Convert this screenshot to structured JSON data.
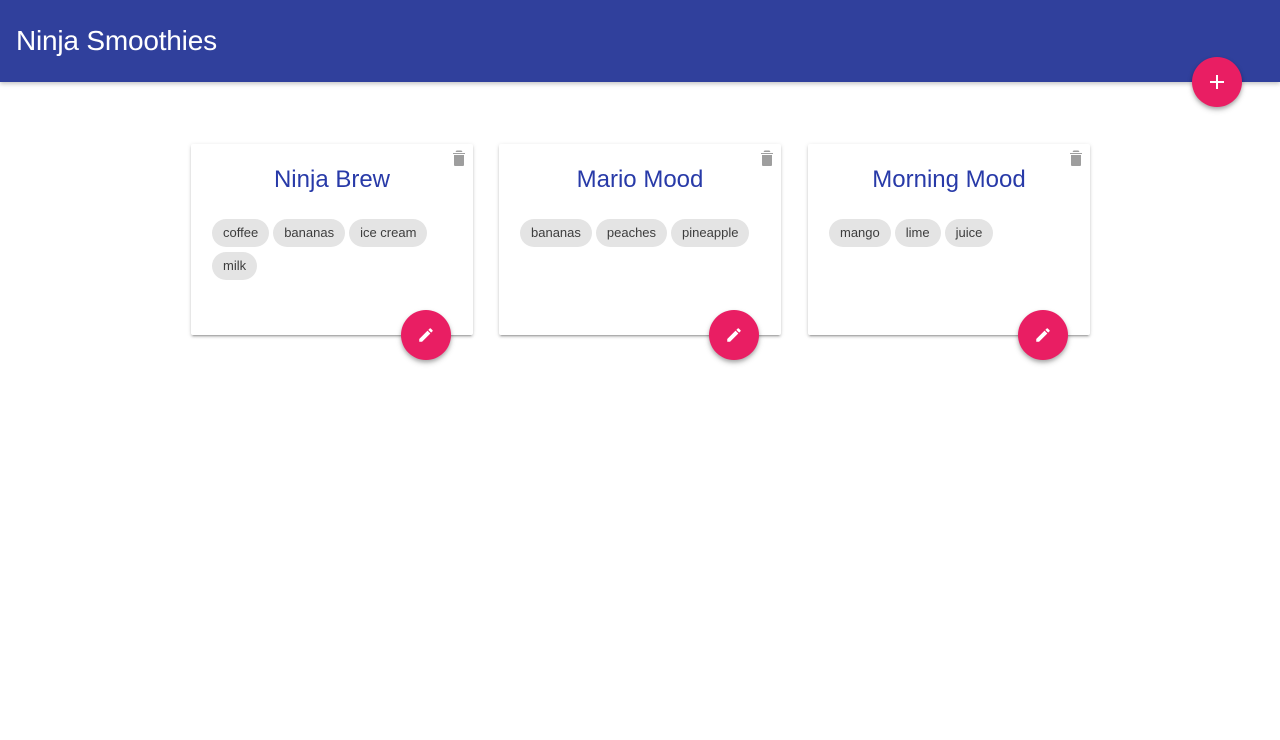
{
  "app": {
    "title": "Ninja Smoothies",
    "colors": {
      "navbar": "#30409c",
      "accent": "#e91e63",
      "title_text": "#283aa8",
      "chip_bg": "#e4e4e4"
    }
  },
  "header": {
    "add_button": {
      "icon": "plus-icon"
    }
  },
  "smoothies": [
    {
      "title": "Ninja Brew",
      "ingredients": [
        "coffee",
        "bananas",
        "ice cream",
        "milk"
      ]
    },
    {
      "title": "Mario Mood",
      "ingredients": [
        "bananas",
        "peaches",
        "pineapple"
      ]
    },
    {
      "title": "Morning Mood",
      "ingredients": [
        "mango",
        "lime",
        "juice"
      ]
    }
  ],
  "card_icons": {
    "delete": "trash-icon",
    "edit": "pencil-icon"
  }
}
